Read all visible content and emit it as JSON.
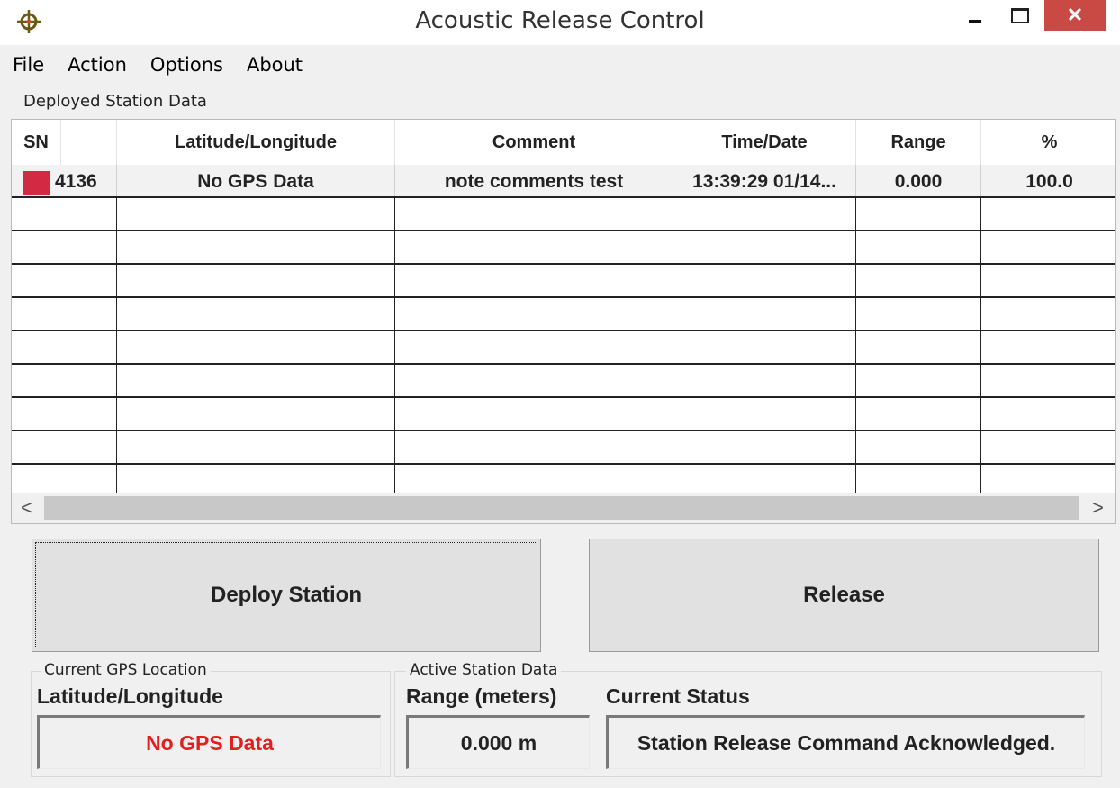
{
  "window": {
    "title": "Acoustic Release Control",
    "close_symbol": "✕",
    "icon": "crosshair-icon"
  },
  "menu": [
    "File",
    "Action",
    "Options",
    "About"
  ],
  "deployed_group": {
    "title": "Deployed Station Data"
  },
  "table": {
    "columns": [
      "SN",
      "Latitude/Longitude",
      "Comment",
      "Time/Date",
      "Range",
      "%"
    ],
    "rows": [
      {
        "sn": "4136",
        "lat_long": "No GPS Data",
        "comment": "note comments test",
        "time_date": "13:39:29 01/14...",
        "range": "0.000",
        "percent": "100.0",
        "marker_color": "#d22a43"
      }
    ],
    "scroll_left": "<",
    "scroll_right": ">"
  },
  "buttons": {
    "deploy": "Deploy Station",
    "release": "Release"
  },
  "gps_group": {
    "title": "Current GPS Location",
    "label": "Latitude/Longitude",
    "value": "No GPS Data",
    "value_color": "#e02020"
  },
  "active_group": {
    "title": "Active Station Data",
    "range_label": "Range (meters)",
    "range_value": "0.000 m",
    "status_label": "Current Status",
    "status_value": "Station Release Command Acknowledged."
  }
}
